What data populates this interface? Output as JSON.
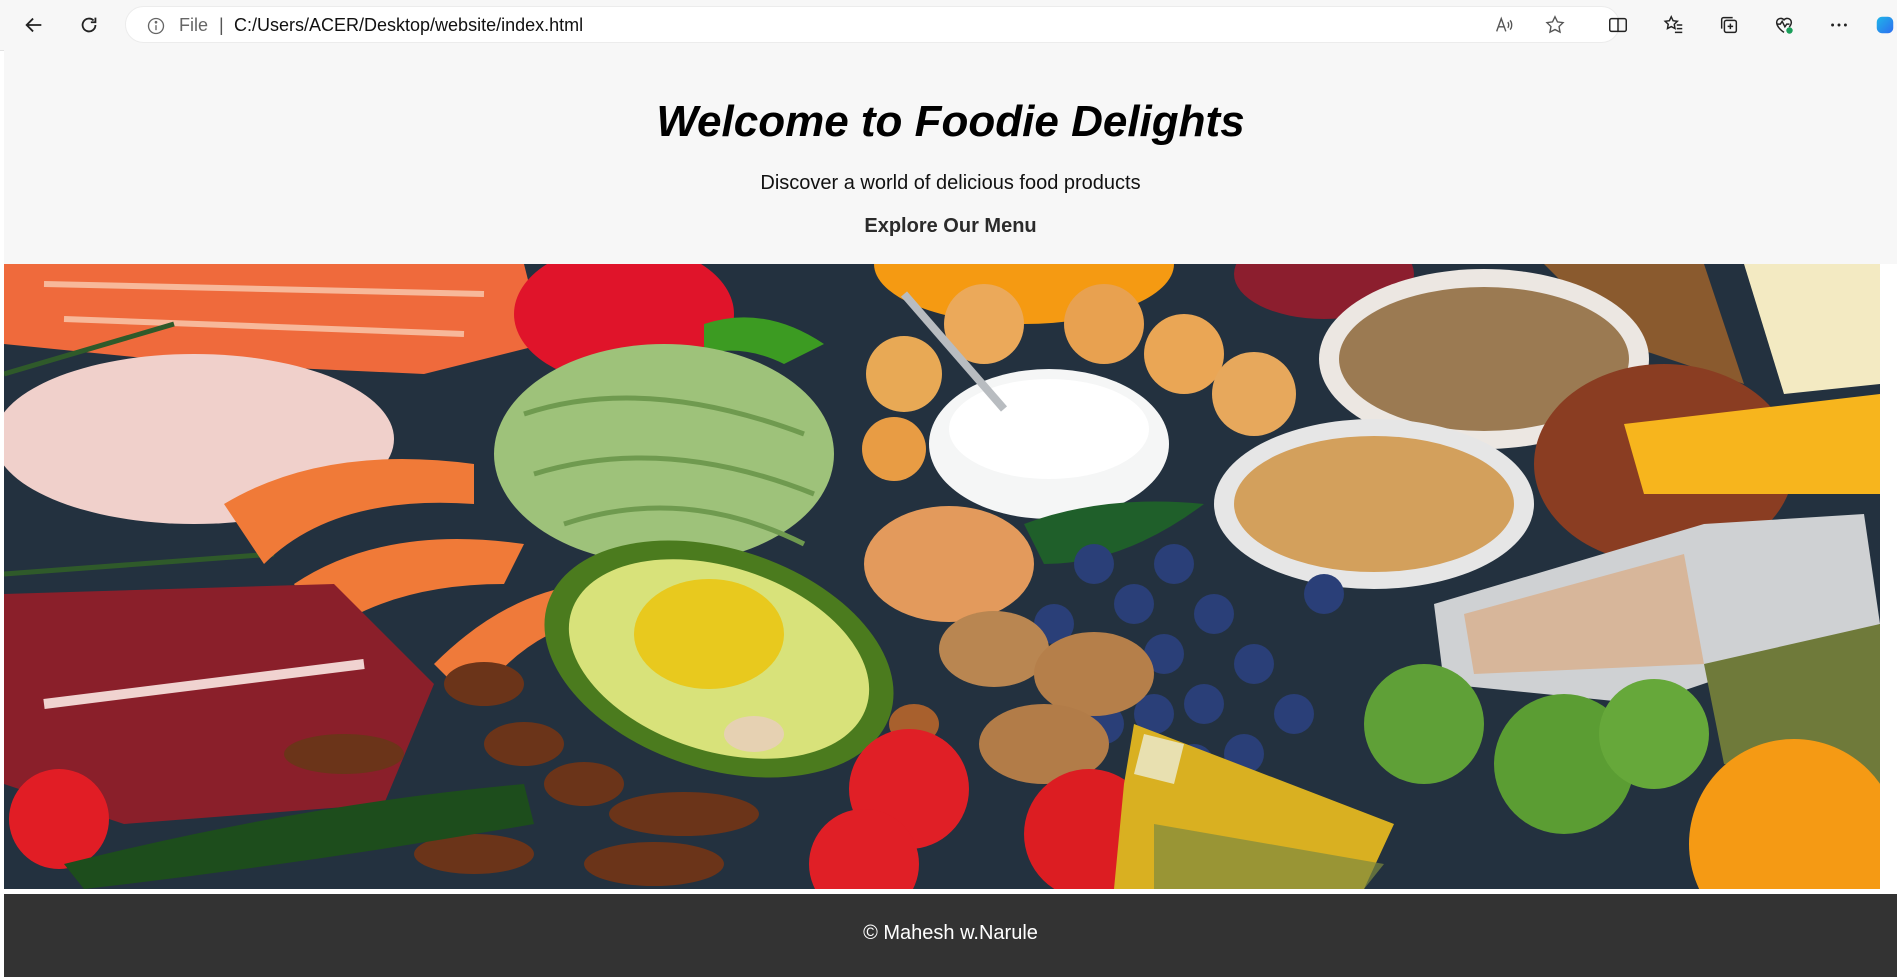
{
  "browser": {
    "address": {
      "scheme_label": "File",
      "separator": "|",
      "url": "C:/Users/ACER/Desktop/website/index.html"
    },
    "icons": [
      "back-icon",
      "refresh-icon",
      "info-icon",
      "read-aloud-icon",
      "favorite-star-icon",
      "split-screen-icon",
      "favorites-icon",
      "collections-icon",
      "browser-essentials-icon",
      "more-icon",
      "copilot-icon"
    ]
  },
  "header": {
    "title": "Welcome to Foodie Delights",
    "tagline": "Discover a world of delicious food products",
    "menu_link": "Explore Our Menu"
  },
  "hero": {
    "image_description": "food"
  },
  "footer": {
    "copyright": "© Mahesh w.Narule"
  },
  "colors": {
    "header_bg": "#f7f7f7",
    "footer_bg": "#333333",
    "footer_text": "#ffffff"
  }
}
